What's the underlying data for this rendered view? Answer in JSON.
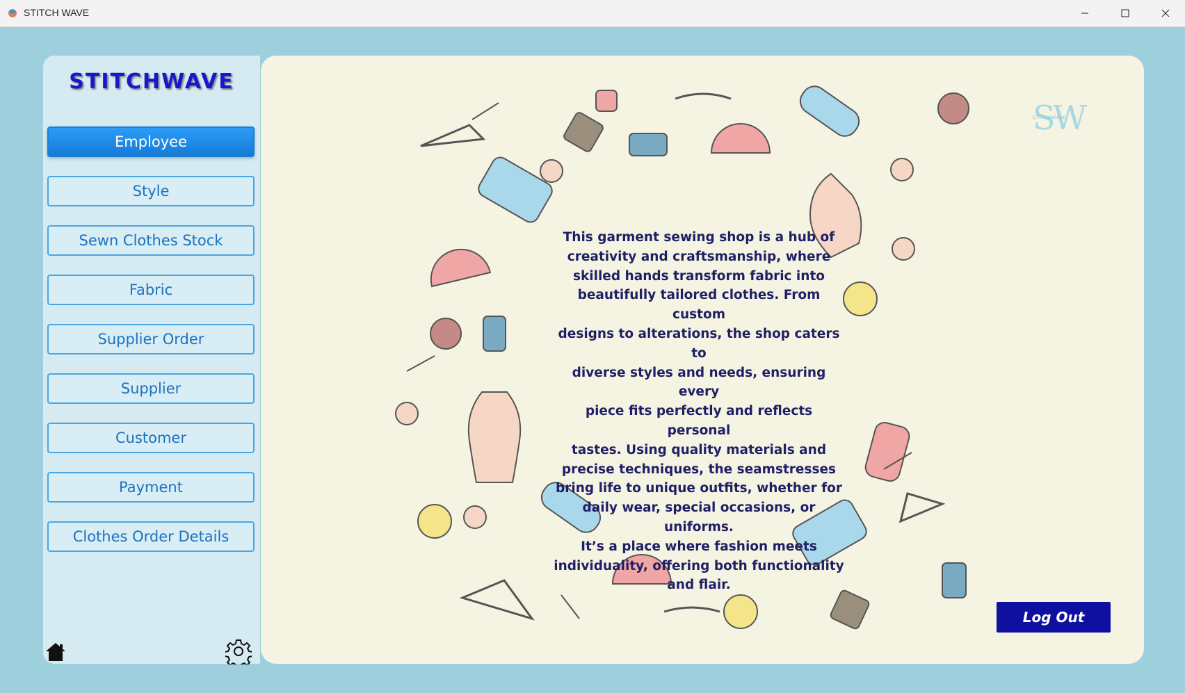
{
  "window": {
    "title": "STITCH WAVE"
  },
  "sidebar": {
    "brand": "STITCHWAVE",
    "items": [
      {
        "label": "Employee",
        "active": true
      },
      {
        "label": "Style"
      },
      {
        "label": "Sewn Clothes Stock"
      },
      {
        "label": "Fabric"
      },
      {
        "label": "Supplier Order"
      },
      {
        "label": "Supplier"
      },
      {
        "label": "Customer"
      },
      {
        "label": "Payment"
      },
      {
        "label": "Clothes Order Details"
      }
    ],
    "footer_icons": [
      "home-icon",
      "gear-icon"
    ]
  },
  "main": {
    "description_lines": [
      "This garment sewing shop is a hub of",
      "creativity and craftsmanship, where",
      "skilled hands transform fabric into",
      "beautifully tailored clothes. From custom",
      "designs to alterations, the shop caters to",
      "diverse styles and needs, ensuring every",
      "piece fits perfectly and reflects personal",
      "tastes. Using quality materials and",
      "precise techniques, the seamstresses",
      "bring life to unique outfits, whether for",
      "daily wear, special occasions, or uniforms.",
      "It’s a place where fashion meets",
      "individuality, offering both functionality",
      "and flair."
    ],
    "logo": {
      "mark": "SW",
      "text": "STITCHWAVE"
    },
    "logout_label": "Log Out"
  },
  "colors": {
    "background": "#9dcfdd",
    "sidebar": "#d5eaf1",
    "main_panel": "#f5f3e2",
    "active_button": "#1f8ce8",
    "button_text": "#1c72c2",
    "brand": "#1a16c9",
    "logout": "#0f0fa0"
  }
}
